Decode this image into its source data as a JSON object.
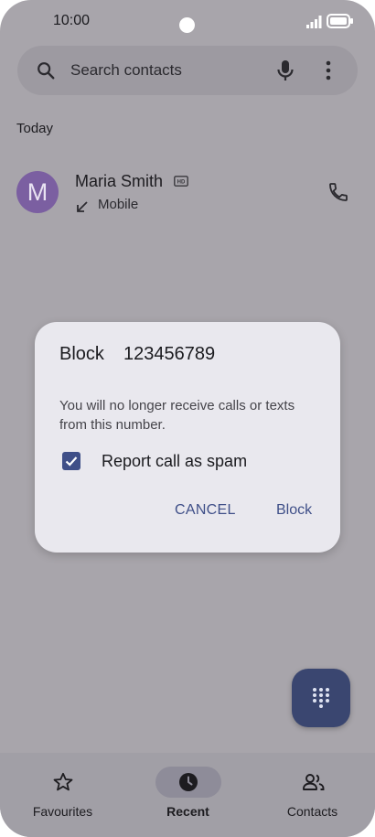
{
  "status": {
    "time": "10:00"
  },
  "search": {
    "placeholder": "Search contacts"
  },
  "recents": {
    "section": "Today",
    "items": [
      {
        "initial": "M",
        "name": "Maria Smith",
        "type": "Mobile"
      }
    ]
  },
  "dialog": {
    "title": "Block",
    "number": "123456789",
    "body": "You will no longer receive calls or texts from this number.",
    "checkbox_label": "Report call as spam",
    "checkbox_checked": true,
    "cancel_label": "CANCEL",
    "confirm_label": "Block"
  },
  "nav": {
    "items": [
      {
        "label": "Favourites",
        "icon": "star-icon"
      },
      {
        "label": "Recent",
        "icon": "clock-icon",
        "active": true
      },
      {
        "label": "Contacts",
        "icon": "people-icon"
      }
    ]
  },
  "colors": {
    "accent": "#3f4f88",
    "avatar": "#7b5fa1",
    "fab": "#3a4670",
    "scrim": "#a8a5ab"
  }
}
